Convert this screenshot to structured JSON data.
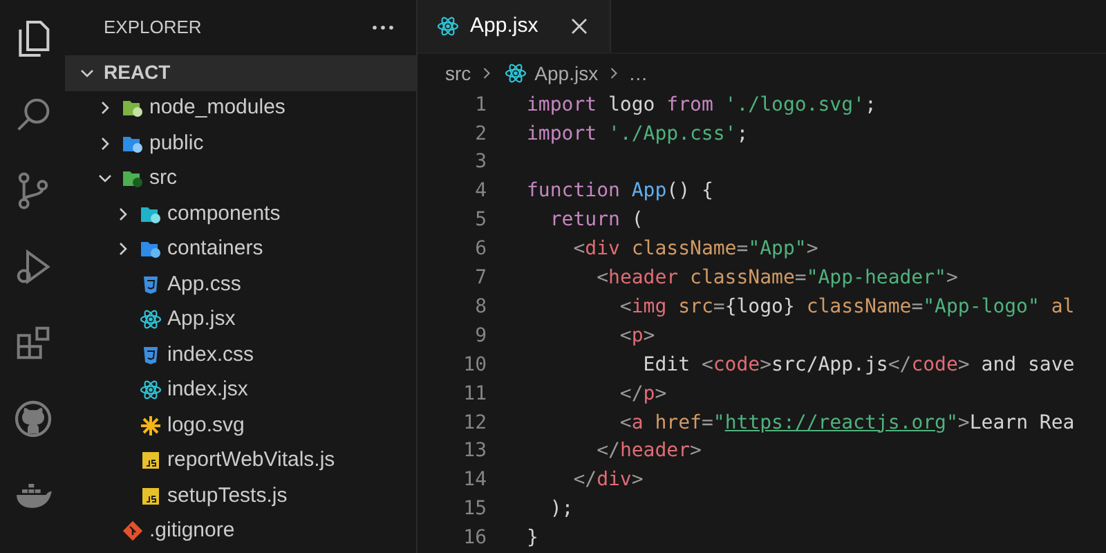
{
  "activity_bar": [
    {
      "kind": "files",
      "selected": true
    },
    {
      "kind": "search",
      "selected": false
    },
    {
      "kind": "source-control",
      "selected": false
    },
    {
      "kind": "run-debug",
      "selected": false
    },
    {
      "kind": "extensions",
      "selected": false
    },
    {
      "kind": "github",
      "selected": false
    },
    {
      "kind": "docker",
      "selected": false
    }
  ],
  "sidebar": {
    "title": "EXPLORER",
    "tree": {
      "label": "REACT",
      "expanded": true,
      "children": [
        {
          "label": "node_modules",
          "kind": "folder-node",
          "expanded": false
        },
        {
          "label": "public",
          "kind": "folder-public",
          "expanded": false
        },
        {
          "label": "src",
          "kind": "folder-src",
          "expanded": true,
          "children": [
            {
              "label": "components",
              "kind": "folder-components",
              "expanded": false
            },
            {
              "label": "containers",
              "kind": "folder-containers",
              "expanded": false
            },
            {
              "label": "App.css",
              "kind": "css"
            },
            {
              "label": "App.jsx",
              "kind": "react"
            },
            {
              "label": "index.css",
              "kind": "css"
            },
            {
              "label": "index.jsx",
              "kind": "react"
            },
            {
              "label": "logo.svg",
              "kind": "svg"
            },
            {
              "label": "reportWebVitals.js",
              "kind": "js"
            },
            {
              "label": "setupTests.js",
              "kind": "js"
            }
          ]
        },
        {
          "label": ".gitignore",
          "kind": "git"
        }
      ]
    }
  },
  "tabs": [
    {
      "label": "App.jsx",
      "kind": "react",
      "selected": true
    }
  ],
  "breadcrumb": [
    {
      "label": "src"
    },
    {
      "label": "App.jsx",
      "kind": "react"
    },
    {
      "label": "…"
    }
  ],
  "code": [
    {
      "number": "1",
      "tokens": [
        {
          "kind": "keyword",
          "text": "import"
        },
        {
          "kind": "plain",
          "text": " logo "
        },
        {
          "kind": "keyword",
          "text": "from"
        },
        {
          "kind": "string",
          "text": " './logo.svg'"
        },
        {
          "kind": "plain",
          "text": ";"
        }
      ]
    },
    {
      "number": "2",
      "tokens": [
        {
          "kind": "keyword",
          "text": "import"
        },
        {
          "kind": "string",
          "text": " './App.css'"
        },
        {
          "kind": "plain",
          "text": ";"
        }
      ]
    },
    {
      "number": "3"
    },
    {
      "number": "4",
      "tokens": [
        {
          "kind": "keyword",
          "text": "function"
        },
        {
          "kind": "function",
          "text": " App"
        },
        {
          "kind": "plain",
          "text": "() {"
        }
      ]
    },
    {
      "number": "5",
      "tokens": [
        {
          "kind": "keyword",
          "text": "  return"
        },
        {
          "kind": "plain",
          "text": " ("
        }
      ]
    },
    {
      "number": "6",
      "tokens": [
        {
          "kind": "punct",
          "text": "    <"
        },
        {
          "kind": "tag",
          "text": "div"
        },
        {
          "kind": "attr",
          "text": " className"
        },
        {
          "kind": "punct",
          "text": "="
        },
        {
          "kind": "string",
          "text": "\"App\""
        },
        {
          "kind": "punct",
          "text": ">"
        }
      ]
    },
    {
      "number": "7",
      "tokens": [
        {
          "kind": "punct",
          "text": "      <"
        },
        {
          "kind": "tag",
          "text": "header"
        },
        {
          "kind": "attr",
          "text": " className"
        },
        {
          "kind": "punct",
          "text": "="
        },
        {
          "kind": "string",
          "text": "\"App-header\""
        },
        {
          "kind": "punct",
          "text": ">"
        }
      ]
    },
    {
      "number": "8",
      "tokens": [
        {
          "kind": "punct",
          "text": "        <"
        },
        {
          "kind": "tag",
          "text": "img"
        },
        {
          "kind": "attr",
          "text": " src"
        },
        {
          "kind": "punct",
          "text": "="
        },
        {
          "kind": "plain",
          "text": "{logo}"
        },
        {
          "kind": "attr",
          "text": " className"
        },
        {
          "kind": "punct",
          "text": "="
        },
        {
          "kind": "string",
          "text": "\"App-logo\""
        },
        {
          "kind": "attr",
          "text": " al"
        }
      ]
    },
    {
      "number": "9",
      "tokens": [
        {
          "kind": "punct",
          "text": "        <"
        },
        {
          "kind": "tag",
          "text": "p"
        },
        {
          "kind": "punct",
          "text": ">"
        }
      ]
    },
    {
      "number": "10",
      "tokens": [
        {
          "kind": "plain",
          "text": "          Edit "
        },
        {
          "kind": "punct",
          "text": "<"
        },
        {
          "kind": "tag",
          "text": "code"
        },
        {
          "kind": "punct",
          "text": ">"
        },
        {
          "kind": "plain",
          "text": "src/App.js"
        },
        {
          "kind": "punct",
          "text": "</"
        },
        {
          "kind": "tag",
          "text": "code"
        },
        {
          "kind": "punct",
          "text": ">"
        },
        {
          "kind": "plain",
          "text": " and save"
        }
      ]
    },
    {
      "number": "11",
      "tokens": [
        {
          "kind": "punct",
          "text": "        </"
        },
        {
          "kind": "tag",
          "text": "p"
        },
        {
          "kind": "punct",
          "text": ">"
        }
      ]
    },
    {
      "number": "12",
      "tokens": [
        {
          "kind": "punct",
          "text": "        <"
        },
        {
          "kind": "tag",
          "text": "a"
        },
        {
          "kind": "attr",
          "text": " href"
        },
        {
          "kind": "punct",
          "text": "="
        },
        {
          "kind": "string",
          "text": "\""
        },
        {
          "kind": "link",
          "text": "https://reactjs.org"
        },
        {
          "kind": "string",
          "text": "\""
        },
        {
          "kind": "punct",
          "text": ">"
        },
        {
          "kind": "plain",
          "text": "Learn Rea"
        }
      ]
    },
    {
      "number": "13",
      "tokens": [
        {
          "kind": "punct",
          "text": "      </"
        },
        {
          "kind": "tag",
          "text": "header"
        },
        {
          "kind": "punct",
          "text": ">"
        }
      ]
    },
    {
      "number": "14",
      "tokens": [
        {
          "kind": "punct",
          "text": "    </"
        },
        {
          "kind": "tag",
          "text": "div"
        },
        {
          "kind": "punct",
          "text": ">"
        }
      ]
    },
    {
      "number": "15",
      "tokens": [
        {
          "kind": "plain",
          "text": "  );"
        }
      ]
    },
    {
      "number": "16",
      "tokens": [
        {
          "kind": "plain",
          "text": "}"
        }
      ]
    }
  ]
}
